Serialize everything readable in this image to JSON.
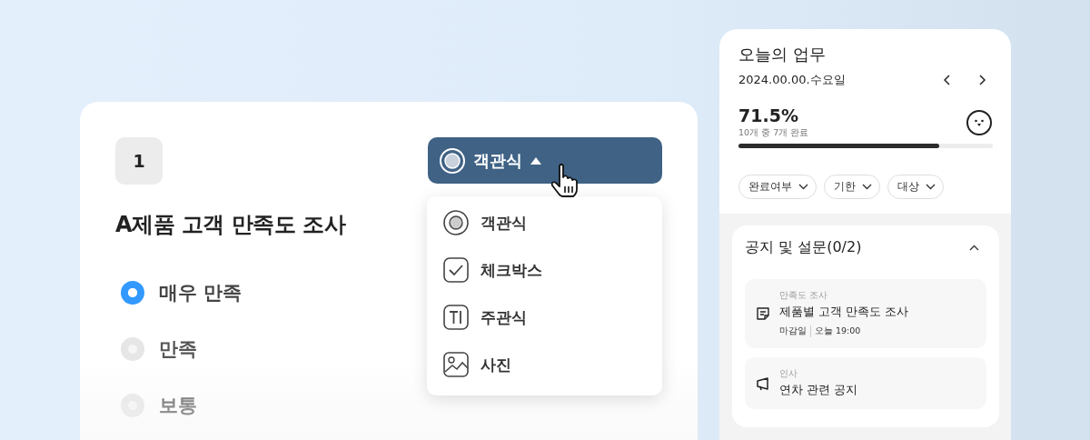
{
  "question": {
    "number": "1",
    "title": "A제품 고객 만족도 조사",
    "options": [
      {
        "label": "매우 만족",
        "selected": true
      },
      {
        "label": "만족",
        "selected": false
      },
      {
        "label": "보통",
        "selected": false
      }
    ]
  },
  "type_dropdown": {
    "value": "객관식",
    "expanded": true,
    "items": [
      {
        "kind": "radio",
        "label": "객관식"
      },
      {
        "kind": "checkbox",
        "label": "체크박스"
      },
      {
        "kind": "text",
        "label": "주관식"
      },
      {
        "kind": "photo",
        "label": "사진"
      }
    ]
  },
  "today_panel": {
    "title": "오늘의 업무",
    "date": "2024.00.00.수요일",
    "percent": "71.5%",
    "summary": "10개 중 7개 완료",
    "progress": {
      "level": 0.79
    },
    "filters": [
      "완료여부",
      "기한",
      "대상"
    ],
    "section": {
      "title": "공지 및 설문(0/2)",
      "expanded": true,
      "items": [
        {
          "kind": "survey",
          "category": "만족도 조사",
          "title": "제품별 고객 만족도 조사",
          "deadline_label": "마감일",
          "deadline": "오늘 19:00"
        },
        {
          "kind": "notice",
          "category": "인사",
          "title": "연차 관련 공지"
        }
      ]
    }
  }
}
